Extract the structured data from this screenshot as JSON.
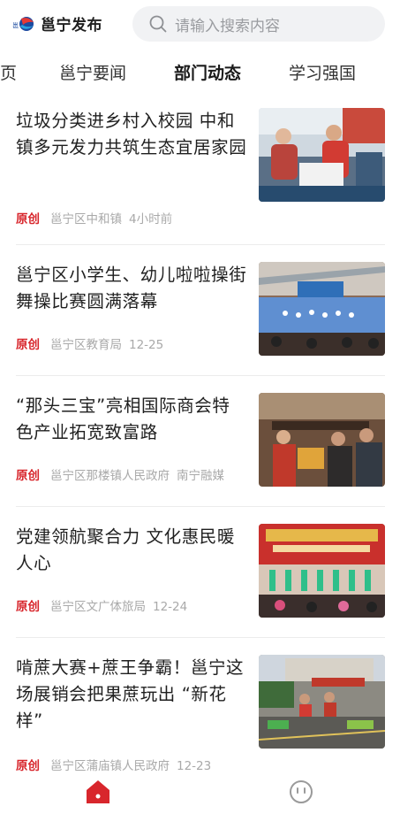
{
  "header": {
    "app_name": "邕宁发布",
    "search_placeholder": "请输入搜索内容"
  },
  "tabs": [
    {
      "label": "页"
    },
    {
      "label": "邕宁要闻"
    },
    {
      "label": "部门动态",
      "active": true
    },
    {
      "label": "学习强国"
    }
  ],
  "feed": [
    {
      "title": "垃圾分类进乡村入校园 中和镇多元发力共筑生态宜居家园",
      "tag": "原创",
      "source": "邕宁区中和镇",
      "extra": "",
      "time": "4小时前",
      "image": "photo-recycling-event"
    },
    {
      "title": "邕宁区小学生、幼儿啦啦操街舞操比赛圆满落幕",
      "tag": "原创",
      "source": "邕宁区教育局",
      "extra": "",
      "time": "12-25",
      "image": "photo-cheerleading-gym"
    },
    {
      "title": "“那头三宝”亮相国际商会特色产业拓宽致富路",
      "tag": "原创",
      "source": "邕宁区那楼镇人民政府",
      "extra": "南宁融媒",
      "time": "",
      "image": "photo-trade-fair"
    },
    {
      "title": "党建领航聚合力 文化惠民暖人心",
      "tag": "原创",
      "source": "邕宁区文广体旅局",
      "extra": "",
      "time": "12-24",
      "image": "photo-stage-performance"
    },
    {
      "title": "啃蔗大赛+蔗王争霸！邕宁这场展销会把果蔗玩出 “新花样”",
      "tag": "原创",
      "source": "邕宁区蒲庙镇人民政府",
      "extra": "",
      "time": "12-23",
      "image": "photo-sugarcane-festival"
    }
  ],
  "bottom_nav": {
    "home_icon": "home-icon",
    "mine_icon": "face-icon",
    "accent": "#d8262c"
  }
}
